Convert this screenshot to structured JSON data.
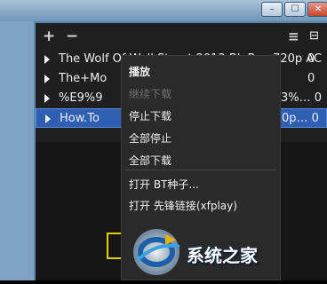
{
  "window": {
    "controls": {
      "minimize": "–",
      "maximize": "☐",
      "close": "✕"
    }
  },
  "toolbar": {
    "add_label": "+",
    "remove_label": "−",
    "list_label": "≡",
    "view_label": "⊟"
  },
  "rows": [
    {
      "name": "The Wolf Of Wall Street 2013 BluRay 720p AC",
      "extra": "0"
    },
    {
      "name": "The+Mo",
      "extra": "0"
    },
    {
      "name": "%E9%9",
      "extra": "3%… 0"
    },
    {
      "name": "How.To",
      "extra": "0p… 0"
    }
  ],
  "menu": {
    "items": [
      {
        "label": "播放",
        "state": "bold"
      },
      {
        "label": "继续下载",
        "state": "disabled"
      },
      {
        "label": "停止下载",
        "state": "normal"
      },
      {
        "label": "全部停止",
        "state": "normal"
      },
      {
        "label": "全部下载",
        "state": "normal"
      },
      {
        "label": "打开 BT种子...",
        "state": "normal"
      },
      {
        "label": "打开 先锋链接(xfplay)",
        "state": "normal"
      }
    ]
  },
  "watermark": {
    "text": "系统之家"
  },
  "colors": {
    "selection": "#2f5fb3",
    "menu_bg": "#2a2a2a",
    "highlight_box": "#e2d100"
  }
}
